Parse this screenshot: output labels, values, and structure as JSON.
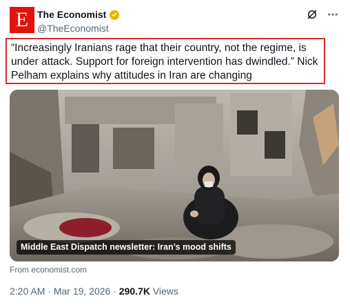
{
  "account": {
    "display_name": "The Economist",
    "handle": "@TheEconomist",
    "avatar_letter": "E",
    "brand_color": "#e3120b",
    "verified_color": "#e8b400"
  },
  "tweet": {
    "text": "“Increasingly Iranians rage that their country, not the regime, is under attack. Support for foreign intervention has dwindled.” Nick Pelham explains why attitudes in Iran are changing",
    "highlight_color": "#d9262c"
  },
  "media": {
    "caption": "Middle East Dispatch newsletter: Iran’s mood shifts"
  },
  "source": {
    "prefix": "From ",
    "domain": "economist.com"
  },
  "meta": {
    "time": "2:20 AM",
    "separator1": " · ",
    "date": "Mar 19, 2026",
    "separator2": " · ",
    "views_count": "290.7K",
    "views_label": " Views"
  },
  "icons": {
    "verified": "verified-badge-icon",
    "grok": "grok-icon",
    "more": "more-icon"
  }
}
